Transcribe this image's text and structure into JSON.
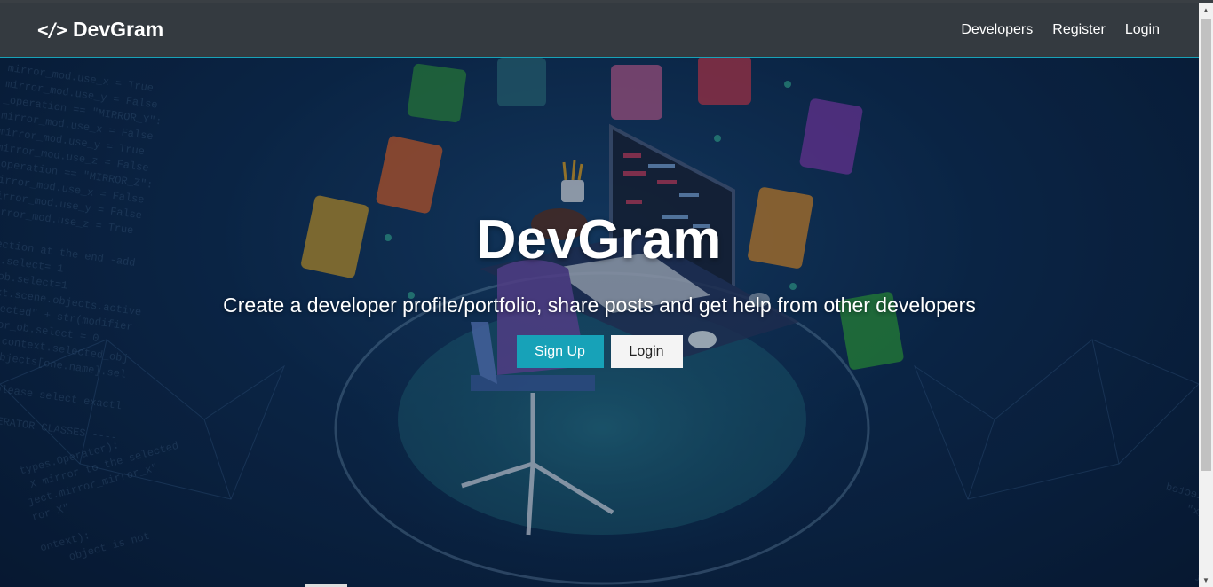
{
  "navbar": {
    "brand_icon": "</>",
    "brand_name": "DevGram",
    "links": [
      {
        "label": "Developers"
      },
      {
        "label": "Register"
      },
      {
        "label": "Login"
      }
    ]
  },
  "landing": {
    "title": "DevGram",
    "lead": "Create a developer profile/portfolio, share posts and get help from other developers",
    "buttons": {
      "signup": "Sign Up",
      "login": "Login"
    }
  },
  "colors": {
    "navbar_bg": "#343a40",
    "accent": "#17a2b8",
    "light_button": "#f4f4f4"
  }
}
